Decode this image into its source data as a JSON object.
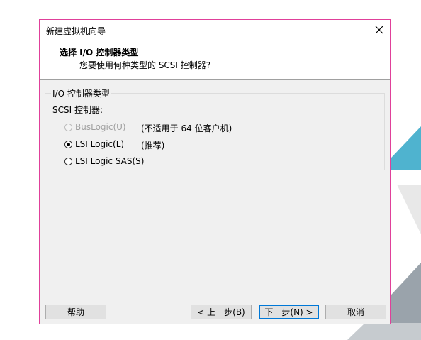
{
  "window": {
    "title": "新建虚拟机向导"
  },
  "header": {
    "title": "选择 I/O 控制器类型",
    "subtitle": "您要使用何种类型的 SCSI 控制器?"
  },
  "group": {
    "legend": "I/O 控制器类型",
    "scsi_label": "SCSI 控制器:",
    "options": [
      {
        "label": "BusLogic(U)",
        "note": "(不适用于 64 位客户机)",
        "checked": false,
        "enabled": false
      },
      {
        "label": "LSI Logic(L)",
        "note": "(推荐)",
        "checked": true,
        "enabled": true
      },
      {
        "label": "LSI Logic SAS(S)",
        "note": "",
        "checked": false,
        "enabled": true
      }
    ]
  },
  "buttons": {
    "help": "帮助",
    "back": "< 上一步(B)",
    "next": "下一步(N) >",
    "cancel": "取消"
  },
  "colors": {
    "window_border": "#e0409a",
    "accent": "#0078d7",
    "teal": "#4fb3cf",
    "gray": "#9aa3ab"
  }
}
